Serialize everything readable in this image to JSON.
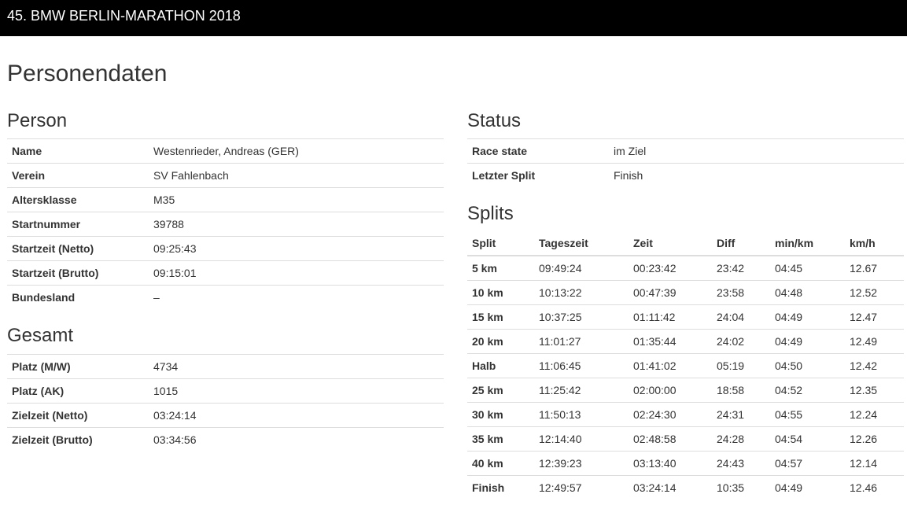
{
  "header": {
    "title": "45. BMW BERLIN-MARATHON 2018"
  },
  "page": {
    "title": "Personendaten"
  },
  "person": {
    "heading": "Person",
    "rows": [
      {
        "label": "Name",
        "value": "Westenrieder, Andreas (GER)"
      },
      {
        "label": "Verein",
        "value": "SV Fahlenbach"
      },
      {
        "label": "Altersklasse",
        "value": "M35"
      },
      {
        "label": "Startnummer",
        "value": "39788"
      },
      {
        "label": "Startzeit (Netto)",
        "value": "09:25:43"
      },
      {
        "label": "Startzeit (Brutto)",
        "value": "09:15:01"
      },
      {
        "label": "Bundesland",
        "value": "–"
      }
    ]
  },
  "gesamt": {
    "heading": "Gesamt",
    "rows": [
      {
        "label": "Platz (M/W)",
        "value": "4734"
      },
      {
        "label": "Platz (AK)",
        "value": "1015"
      },
      {
        "label": "Zielzeit (Netto)",
        "value": "03:24:14"
      },
      {
        "label": "Zielzeit (Brutto)",
        "value": "03:34:56"
      }
    ]
  },
  "status": {
    "heading": "Status",
    "rows": [
      {
        "label": "Race state",
        "value": "im Ziel"
      },
      {
        "label": "Letzter Split",
        "value": "Finish"
      }
    ]
  },
  "splits": {
    "heading": "Splits",
    "columns": [
      "Split",
      "Tageszeit",
      "Zeit",
      "Diff",
      "min/km",
      "km/h"
    ],
    "rows": [
      [
        "5 km",
        "09:49:24",
        "00:23:42",
        "23:42",
        "04:45",
        "12.67"
      ],
      [
        "10 km",
        "10:13:22",
        "00:47:39",
        "23:58",
        "04:48",
        "12.52"
      ],
      [
        "15 km",
        "10:37:25",
        "01:11:42",
        "24:04",
        "04:49",
        "12.47"
      ],
      [
        "20 km",
        "11:01:27",
        "01:35:44",
        "24:02",
        "04:49",
        "12.49"
      ],
      [
        "Halb",
        "11:06:45",
        "01:41:02",
        "05:19",
        "04:50",
        "12.42"
      ],
      [
        "25 km",
        "11:25:42",
        "02:00:00",
        "18:58",
        "04:52",
        "12.35"
      ],
      [
        "30 km",
        "11:50:13",
        "02:24:30",
        "24:31",
        "04:55",
        "12.24"
      ],
      [
        "35 km",
        "12:14:40",
        "02:48:58",
        "24:28",
        "04:54",
        "12.26"
      ],
      [
        "40 km",
        "12:39:23",
        "03:13:40",
        "24:43",
        "04:57",
        "12.14"
      ],
      [
        "Finish",
        "12:49:57",
        "03:24:14",
        "10:35",
        "04:49",
        "12.46"
      ]
    ]
  }
}
